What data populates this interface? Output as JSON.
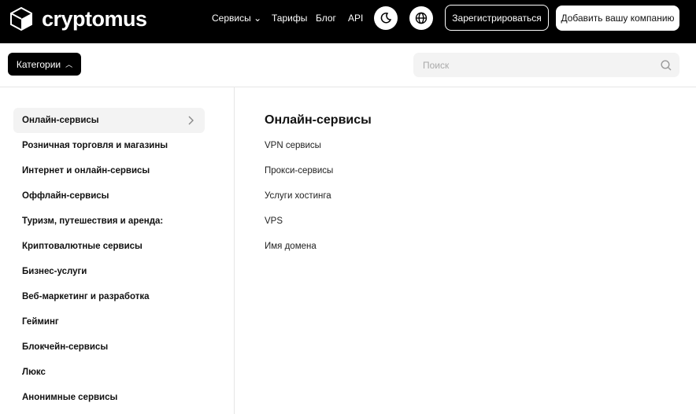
{
  "header": {
    "brand": "cryptomus",
    "nav": [
      "Сервисы",
      "Тарифы",
      "Блог",
      "API"
    ],
    "register": "Зарегистрироваться",
    "add_company": "Добавить вашу компанию"
  },
  "toolbar": {
    "categories": "Категории",
    "search_placeholder": "Поиск"
  },
  "sidebar": {
    "items": [
      "Онлайн-сервисы",
      "Розничная торговля и магазины",
      "Интернет и онлайн-сервисы",
      "Оффлайн-сервисы",
      "Туризм, путешествия и аренда:",
      "Криптовалютные сервисы",
      "Бизнес-услуги",
      "Веб-маркетинг и разработка",
      "Гейминг",
      "Блокчейн-сервисы",
      "Люкс",
      "Анонимные сервисы"
    ]
  },
  "main": {
    "title": "Онлайн-сервисы",
    "links": [
      "VPN сервисы",
      "Прокси-сервисы",
      "Услуги хостинга",
      "VPS",
      "Имя домена"
    ]
  }
}
